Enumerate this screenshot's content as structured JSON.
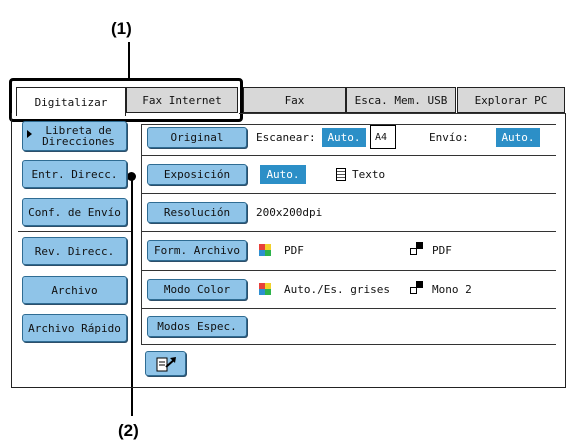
{
  "callouts": {
    "top": "(1)",
    "bottom": "(2)"
  },
  "tabs": [
    {
      "label": "Digitalizar",
      "active": true
    },
    {
      "label": "Fax Internet",
      "active": false
    },
    {
      "label": "Fax",
      "active": false
    },
    {
      "label": "Esca. Mem. USB",
      "active": false
    },
    {
      "label": "Explorar PC",
      "active": false
    }
  ],
  "sidebar": [
    {
      "label": "Libreta de Direcciones"
    },
    {
      "label": "Entr. Direcc."
    },
    {
      "label": "Conf. de Envío"
    },
    {
      "label": "Rev. Direcc."
    },
    {
      "label": "Archivo"
    },
    {
      "label": "Archivo Rápido"
    }
  ],
  "settings": {
    "original": {
      "button": "Original",
      "scan_label": "Escanear:",
      "scan_value": "Auto.",
      "paper": "A4",
      "send_label": "Envío:",
      "send_value": "Auto."
    },
    "exposure": {
      "button": "Exposición",
      "value": "Auto.",
      "option": "Texto"
    },
    "resolution": {
      "button": "Resolución",
      "value": "200x200dpi"
    },
    "file_format": {
      "button": "Form. Archivo",
      "color_format": "PDF",
      "bw_format": "PDF"
    },
    "color_mode": {
      "button": "Modo Color",
      "color_value": "Auto./Es. grises",
      "bw_value": "Mono 2"
    },
    "special_modes": {
      "button": "Modos Espec."
    }
  },
  "icons": {
    "preview": "preview-icon"
  },
  "colors": {
    "accent": "#2c8fc7",
    "button": "#8fc4e8"
  }
}
